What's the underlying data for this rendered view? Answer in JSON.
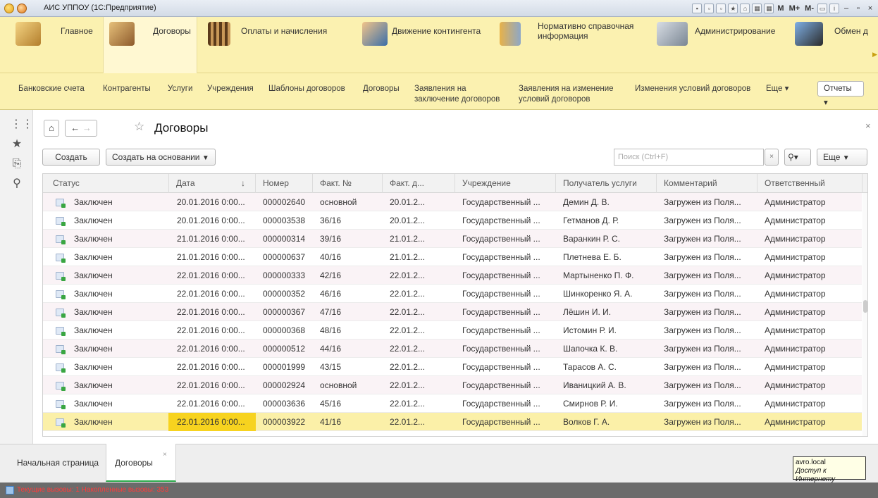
{
  "window": {
    "title": "АИС УППОУ (1С:Предприятие)"
  },
  "sections": [
    {
      "label": "Главное",
      "icon": "main-section-icon"
    },
    {
      "label": "Договоры",
      "icon": "contracts-section-icon",
      "active": true
    },
    {
      "label": "Оплаты и начисления",
      "icon": "payments-section-icon"
    },
    {
      "label": "Движение контингента",
      "icon": "contingent-section-icon"
    },
    {
      "label_line1": "Нормативно справочная",
      "label_line2": "информация",
      "icon": "reference-section-icon"
    },
    {
      "label": "Администрирование",
      "icon": "admin-section-icon"
    },
    {
      "label": "Обмен д",
      "icon": "exchange-section-icon"
    }
  ],
  "nav": {
    "items": [
      "Банковские счета",
      "Контрагенты",
      "Услуги",
      "Учреждения",
      "Шаблоны договоров",
      "Договоры"
    ],
    "applications_line1": "Заявления на",
    "applications_line2": "заключение договоров",
    "change_line1": "Заявления на изменение",
    "change_line2": "условий договоров",
    "changes": "Изменения условий договоров",
    "more": "Еще ▾",
    "reports": "Отчеты ▾"
  },
  "form": {
    "title": "Договоры",
    "create": "Создать",
    "create_based": "Создать на основании",
    "search_placeholder": "Поиск (Ctrl+F)",
    "more": "Еще"
  },
  "table": {
    "columns": [
      "Статус",
      "Дата",
      "Номер",
      "Факт. №",
      "Факт. д...",
      "Учреждение",
      "Получатель услуги",
      "Комментарий",
      "Ответственный"
    ],
    "sort_indicator": "↓",
    "rows": [
      [
        "Заключен",
        "20.01.2016 0:00...",
        "000002640",
        "основной",
        "20.01.2...",
        "Государственный ...",
        "Демин Д. В.",
        "Загружен из Поля...",
        "Администратор"
      ],
      [
        "Заключен",
        "20.01.2016 0:00...",
        "000003538",
        "36/16",
        "20.01.2...",
        "Государственный ...",
        "Гетманов Д. Р.",
        "Загружен из Поля...",
        "Администратор"
      ],
      [
        "Заключен",
        "21.01.2016 0:00...",
        "000000314",
        "39/16",
        "21.01.2...",
        "Государственный ...",
        "Варанкин Р. С.",
        "Загружен из Поля...",
        "Администратор"
      ],
      [
        "Заключен",
        "21.01.2016 0:00...",
        "000000637",
        "40/16",
        "21.01.2...",
        "Государственный ...",
        "Плетнева Е. Б.",
        "Загружен из Поля...",
        "Администратор"
      ],
      [
        "Заключен",
        "22.01.2016 0:00...",
        "000000333",
        "42/16",
        "22.01.2...",
        "Государственный ...",
        "Мартыненко П. Ф.",
        "Загружен из Поля...",
        "Администратор"
      ],
      [
        "Заключен",
        "22.01.2016 0:00...",
        "000000352",
        "46/16",
        "22.01.2...",
        "Государственный ...",
        "Шинкоренко Я. А.",
        "Загружен из Поля...",
        "Администратор"
      ],
      [
        "Заключен",
        "22.01.2016 0:00...",
        "000000367",
        "47/16",
        "22.01.2...",
        "Государственный ...",
        "Лёшин И. И.",
        "Загружен из Поля...",
        "Администратор"
      ],
      [
        "Заключен",
        "22.01.2016 0:00...",
        "000000368",
        "48/16",
        "22.01.2...",
        "Государственный ...",
        "Истомин Р. И.",
        "Загружен из Поля...",
        "Администратор"
      ],
      [
        "Заключен",
        "22.01.2016 0:00...",
        "000000512",
        "44/16",
        "22.01.2...",
        "Государственный ...",
        "Шапочка К. В.",
        "Загружен из Поля...",
        "Администратор"
      ],
      [
        "Заключен",
        "22.01.2016 0:00...",
        "000001999",
        "43/15",
        "22.01.2...",
        "Государственный ...",
        "Тарасов А. С.",
        "Загружен из Поля...",
        "Администратор"
      ],
      [
        "Заключен",
        "22.01.2016 0:00...",
        "000002924",
        "основной",
        "22.01.2...",
        "Государственный ...",
        "Иваницкий А. В.",
        "Загружен из Поля...",
        "Администратор"
      ],
      [
        "Заключен",
        "22.01.2016 0:00...",
        "000003636",
        "45/16",
        "22.01.2...",
        "Государственный ...",
        "Смирнов Р. И.",
        "Загружен из Поля...",
        "Администратор"
      ],
      [
        "Заключен",
        "22.01.2016 0:00...",
        "000003922",
        "41/16",
        "22.01.2...",
        "Государственный ...",
        "Волков Г. А.",
        "Загружен из Поля...",
        "Администратор"
      ]
    ]
  },
  "bottom_tabs": [
    "Начальная страница",
    "Договоры"
  ],
  "tray": {
    "host": "avro.local",
    "access": "Доступ к Интернету"
  },
  "status": "Текущие вызовы: 1   Накопленные вызовы: 353",
  "colors": {
    "panel_yellow": "#fbf1b0",
    "selected_row": "#fbf0a8",
    "selected_cell": "#f7d31f"
  }
}
